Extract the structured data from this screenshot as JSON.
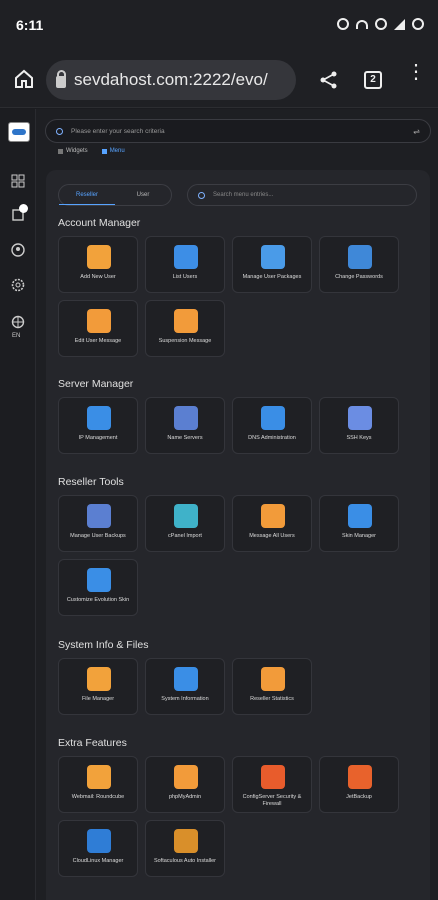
{
  "status": {
    "time": "6:11"
  },
  "browser": {
    "url": "sevdahost.com:2222/evo/",
    "tab_count": "2"
  },
  "sidebar": {
    "label": "EN"
  },
  "search": {
    "placeholder": "Please enter your search criteria"
  },
  "view_toggle": {
    "widgets": "Widgets",
    "menu": "Menu"
  },
  "mode": {
    "reseller": "Reseller",
    "user": "User"
  },
  "menu_search": {
    "placeholder": "Search menu entries..."
  },
  "sections": [
    {
      "title": "Account Manager",
      "items": [
        {
          "label": "Add New User",
          "icon": "user-add-icon",
          "color": "#f2a23b"
        },
        {
          "label": "List Users",
          "icon": "users-icon",
          "color": "#3d8ee6"
        },
        {
          "label": "Manage User Packages",
          "icon": "packages-icon",
          "color": "#4a9be8"
        },
        {
          "label": "Change Passwords",
          "icon": "monitor-icon",
          "color": "#3f88d8"
        },
        {
          "label": "Edit User Message",
          "icon": "message-icon",
          "color": "#f29b3a"
        },
        {
          "label": "Suspension Message",
          "icon": "message-icon",
          "color": "#f29b3a"
        }
      ]
    },
    {
      "title": "Server Manager",
      "items": [
        {
          "label": "IP Management",
          "icon": "network-icon",
          "color": "#3a8ee6"
        },
        {
          "label": "Name Servers",
          "icon": "server-icon",
          "color": "#5b7fd1"
        },
        {
          "label": "DNS Administration",
          "icon": "dns-icon",
          "color": "#3a8ee6"
        },
        {
          "label": "SSH Keys",
          "icon": "key-icon",
          "color": "#6b8de3"
        }
      ]
    },
    {
      "title": "Reseller Tools",
      "items": [
        {
          "label": "Manage User Backups",
          "icon": "backup-icon",
          "color": "#5b7fd1"
        },
        {
          "label": "cPanel Import",
          "icon": "cloud-icon",
          "color": "#3fb2c9"
        },
        {
          "label": "Message All Users",
          "icon": "megaphone-icon",
          "color": "#f29b3a"
        },
        {
          "label": "Skin Manager",
          "icon": "skin-icon",
          "color": "#3a8ee6"
        },
        {
          "label": "Customize Evolution Skin",
          "icon": "customize-icon",
          "color": "#3a8ee6"
        }
      ]
    },
    {
      "title": "System Info & Files",
      "items": [
        {
          "label": "File Manager",
          "icon": "folder-icon",
          "color": "#f2a23b"
        },
        {
          "label": "System Information",
          "icon": "system-icon",
          "color": "#3a8ee6"
        },
        {
          "label": "Reseller Statistics",
          "icon": "stats-icon",
          "color": "#f29b3a"
        }
      ]
    },
    {
      "title": "Extra Features",
      "items": [
        {
          "label": "Webmail: Roundcube",
          "icon": "mail-icon",
          "color": "#f2a23b"
        },
        {
          "label": "phpMyAdmin",
          "icon": "phpmyadmin-icon",
          "color": "#f29b3a"
        },
        {
          "label": "ConfigServer Security & Firewall",
          "icon": "firewall-icon",
          "color": "#e85c2c"
        },
        {
          "label": "JetBackup",
          "icon": "jetbackup-icon",
          "color": "#e8622c"
        },
        {
          "label": "CloudLinux Manager",
          "icon": "cloudlinux-icon",
          "color": "#2f7dd6"
        },
        {
          "label": "Softaculous Auto Installer",
          "icon": "softaculous-icon",
          "color": "#d98f2a"
        }
      ]
    }
  ]
}
